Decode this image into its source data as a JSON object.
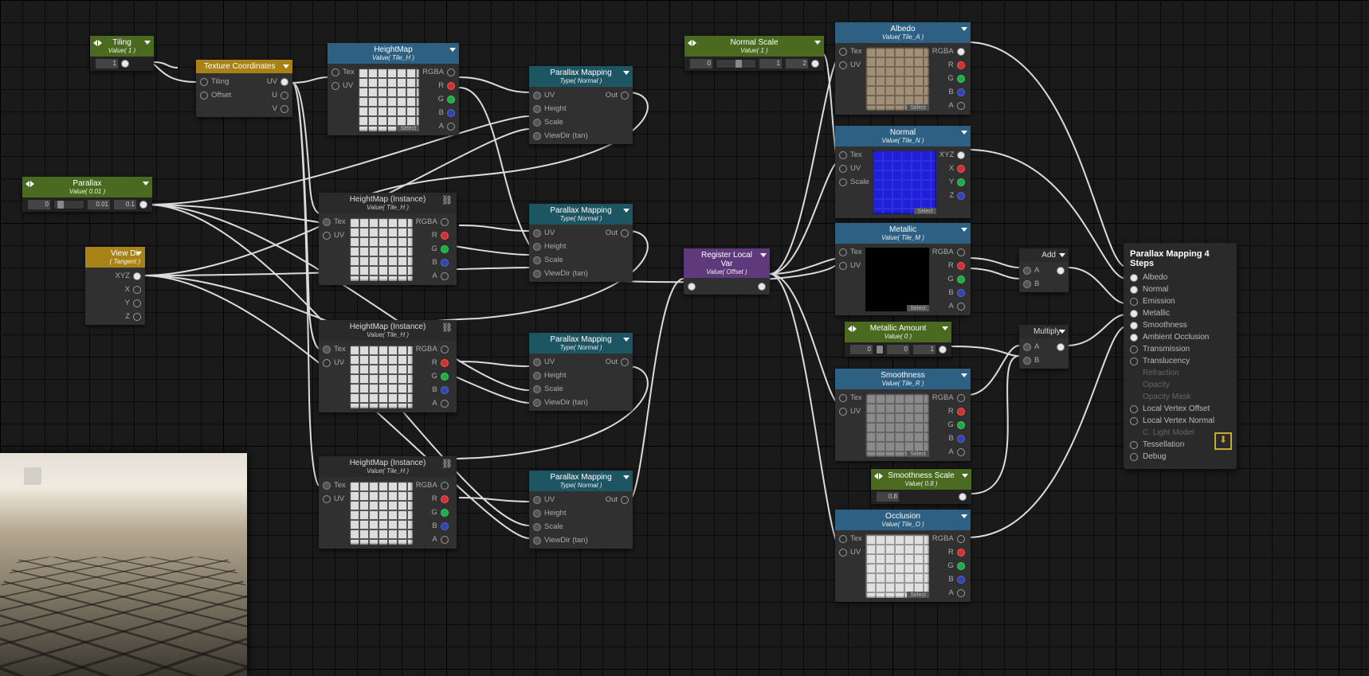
{
  "tiling": {
    "title": "Tiling",
    "sub": "Value( 1 )",
    "slider": {
      "val": "1"
    }
  },
  "texcoord": {
    "title": "Texture Coordinates",
    "in": [
      "Tiling",
      "Offset"
    ],
    "out": [
      "UV",
      "U",
      "V"
    ]
  },
  "heightmap": {
    "title": "HeightMap",
    "sub": "Value( Tile_H )"
  },
  "height_inst": {
    "title": "HeightMap (Instance)",
    "sub": "Value( Tile_H )"
  },
  "sampler_in": [
    "Tex",
    "UV"
  ],
  "sampler_out": [
    "RGBA",
    "R",
    "G",
    "B",
    "A"
  ],
  "parallax": {
    "title": "Parallax",
    "sub": "Value( 0.01 )",
    "val": "0.01",
    "d": "0.1"
  },
  "viewdir": {
    "title": "View Dir",
    "sub": "( Tangent )",
    "out": [
      "XYZ",
      "X",
      "Y",
      "Z"
    ]
  },
  "pmapping": {
    "title": "Parallax Mapping",
    "sub": "Type( Normal )",
    "in": [
      "UV",
      "Height",
      "Scale",
      "ViewDir (tan)"
    ],
    "out": "Out"
  },
  "p_offset_sub": "Value( Offset )",
  "normscale": {
    "title": "Normal Scale",
    "sub": "Value( 1 )",
    "v1": "1",
    "v2": "2"
  },
  "reg": {
    "title": "Register Local Var"
  },
  "albedo": {
    "title": "Albedo",
    "sub": "Value( Tile_A )"
  },
  "normal": {
    "title": "Normal",
    "sub": "Value( Tile_N )",
    "in": [
      "Tex",
      "UV",
      "Scale"
    ],
    "out": [
      "XYZ",
      "X",
      "Y",
      "Z"
    ]
  },
  "metallic": {
    "title": "Metallic",
    "sub": "Value( Tile_M )"
  },
  "metallic_amt": {
    "title": "Metallic Amount",
    "sub": "Value( 0 )",
    "v0": "0",
    "v1": "1"
  },
  "add": {
    "title": "Add",
    "in": [
      "A",
      "B"
    ]
  },
  "mul": {
    "title": "Multiply",
    "in": [
      "A",
      "B"
    ]
  },
  "smooth": {
    "title": "Smoothness",
    "sub": "Value( Tile_R )"
  },
  "smooth_scale": {
    "title": "Smoothness Scale",
    "sub": "Value( 0.8 )",
    "val": "0.8"
  },
  "occ": {
    "title": "Occlusion",
    "sub": "Value( Tile_O )"
  },
  "master": {
    "title": "Parallax Mapping 4 Steps",
    "rows": [
      {
        "t": "Albedo",
        "on": 1
      },
      {
        "t": "Normal",
        "on": 1
      },
      {
        "t": "Emission",
        "hol": 1
      },
      {
        "t": "Metallic",
        "on": 1
      },
      {
        "t": "Smoothness",
        "on": 1
      },
      {
        "t": "Ambient Occlusion",
        "on": 1
      },
      {
        "t": "Transmission",
        "hol": 1
      },
      {
        "t": "Translucency",
        "hol": 1
      },
      {
        "t": "Refraction",
        "dim": 1
      },
      {
        "t": "Opacity",
        "dim": 1
      },
      {
        "t": "Opacity Mask",
        "dim": 1
      },
      {
        "t": "Local Vertex Offset",
        "hol": 1
      },
      {
        "t": "Local Vertex Normal",
        "hol": 1
      },
      {
        "t": "C. Light Model",
        "dim": 1
      },
      {
        "t": "Tessellation",
        "hol": 1
      },
      {
        "t": "Debug",
        "hol": 1
      }
    ]
  },
  "sel_label": "Select"
}
